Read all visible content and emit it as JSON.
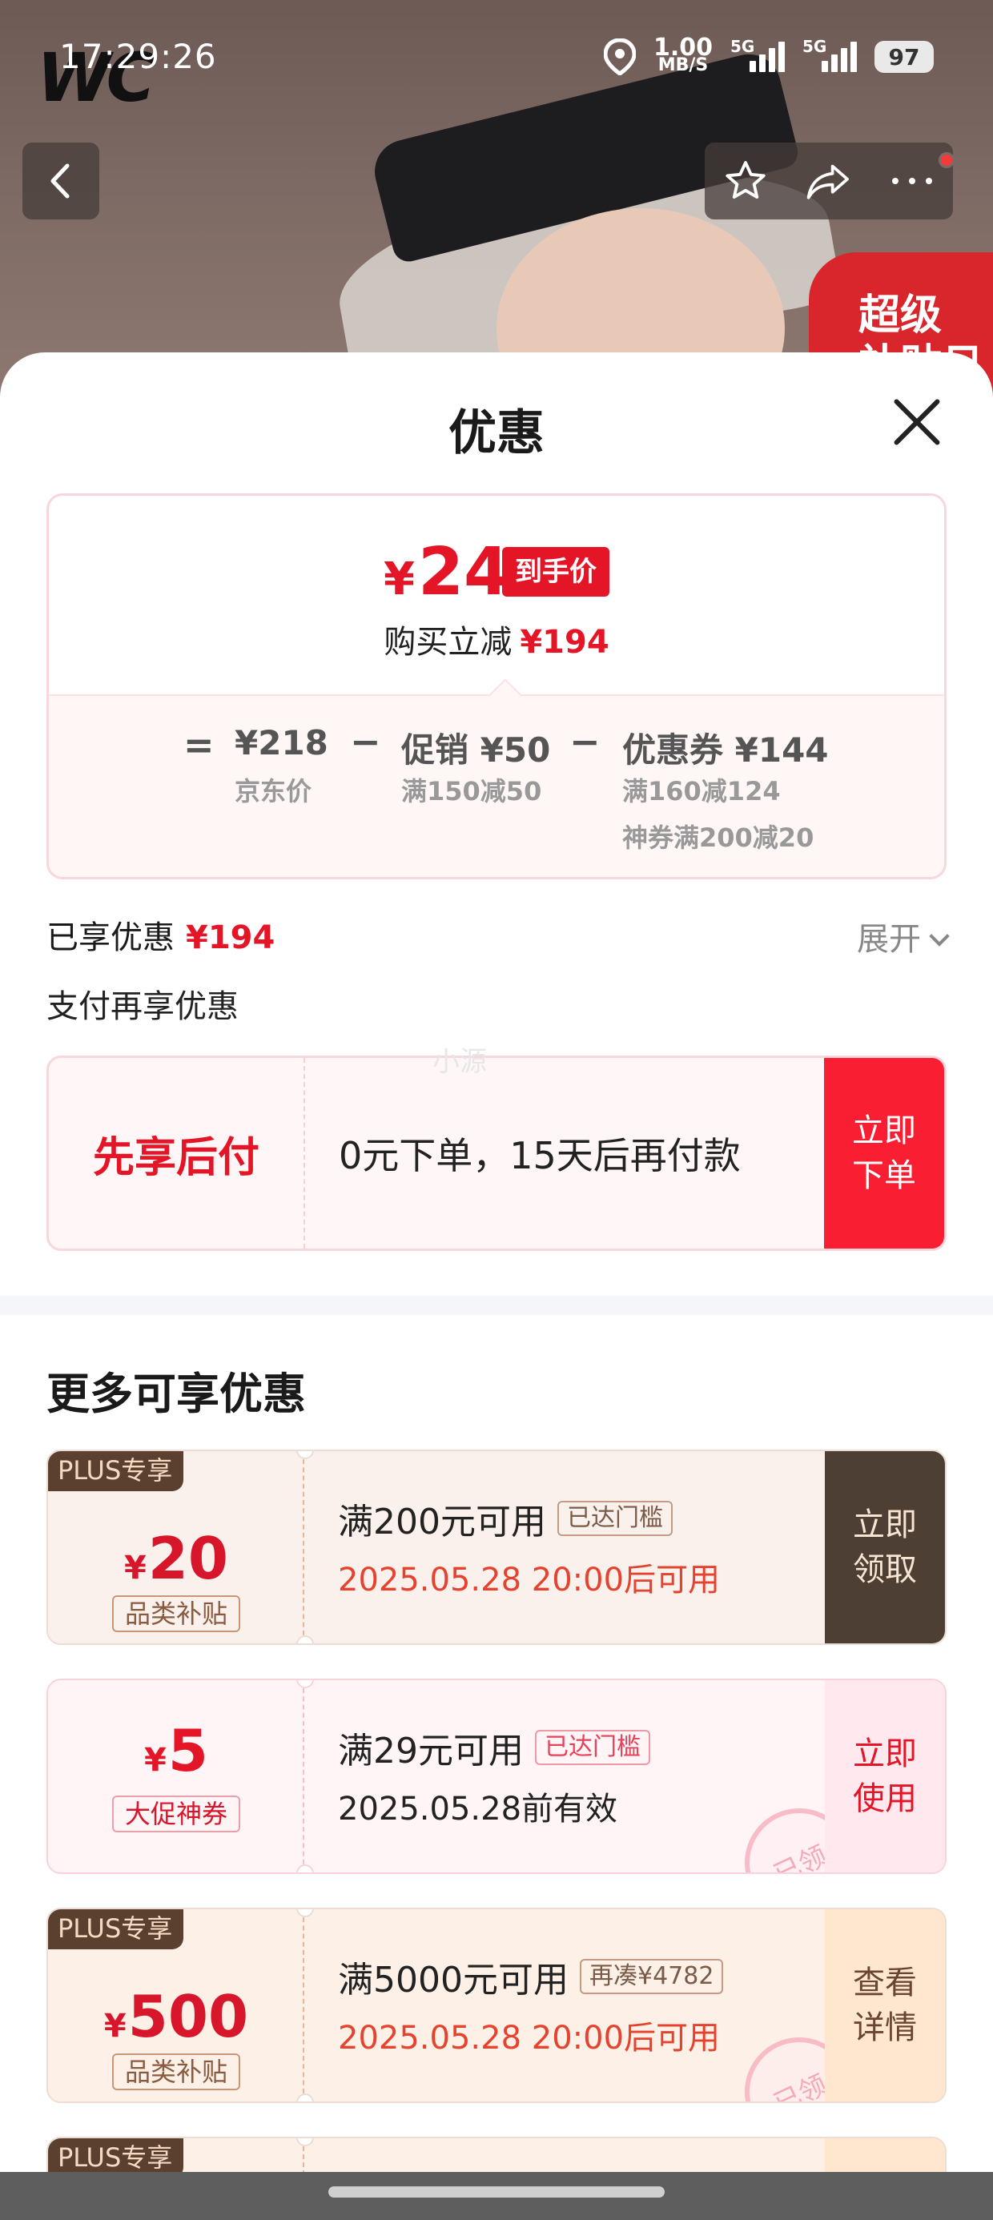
{
  "status_bar": {
    "time": "17:29:26",
    "net_speed_value": "1.00",
    "net_speed_unit": "MB/S",
    "signal_1_label": "5G",
    "signal_2_label": "5G",
    "battery": "97"
  },
  "background": {
    "promo_badge_text": "超级\n补贴日"
  },
  "sheet": {
    "title": "优惠",
    "price_card": {
      "currency_symbol": "¥",
      "final_price": "24",
      "final_tag": "到手价",
      "instant_label": "购买立减",
      "instant_amount": "¥194",
      "equals": "=",
      "minus": "−",
      "jd_price": "¥218",
      "jd_price_label": "京东价",
      "promo_label": "促销 ¥50",
      "promo_detail": "满150减50",
      "coupon_label": "优惠券 ¥144",
      "coupon_detail_1": "满160减124",
      "coupon_detail_2": "神券满200减20"
    },
    "enjoyed": {
      "label": "已享优惠",
      "amount": "¥194",
      "expand_label": "展开"
    },
    "pay": {
      "title": "支付再享优惠",
      "bnpl_name": "先享后付",
      "bnpl_desc": "0元下单，15天后再付款",
      "bnpl_button": "立即下单",
      "watermark": "小源"
    },
    "more": {
      "title": "更多可享优惠",
      "coupons": [
        {
          "plus_tag": "PLUS专享",
          "currency": "¥",
          "amount": "20",
          "category": "品类补贴",
          "condition": "满200元可用",
          "chip": "已达门槛",
          "date": "2025.05.28 20:00后可用",
          "button": "立即领取"
        },
        {
          "currency": "¥",
          "amount": "5",
          "category": "大促神券",
          "condition": "满29元可用",
          "chip": "已达门槛",
          "date": "2025.05.28前有效",
          "button": "立即使用",
          "stamp": "已领"
        },
        {
          "plus_tag": "PLUS专享",
          "currency": "¥",
          "amount": "500",
          "category": "品类补贴",
          "condition": "满5000元可用",
          "chip": "再凑¥4782",
          "date": "2025.05.28 20:00后可用",
          "button": "查看详情",
          "stamp": "已领"
        },
        {
          "plus_tag": "PLUS专享"
        }
      ]
    }
  }
}
